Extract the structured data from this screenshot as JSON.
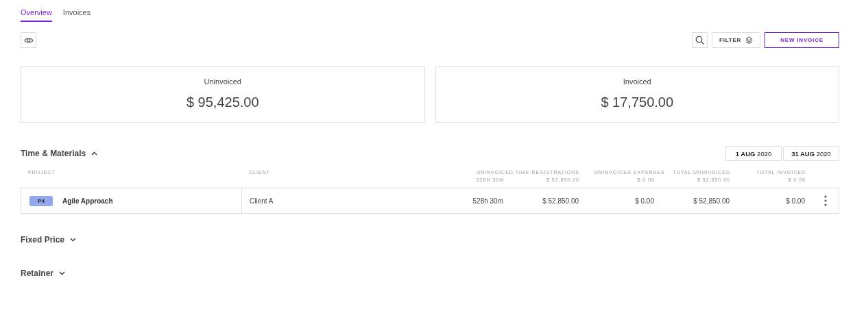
{
  "tabs": [
    {
      "label": "Overview",
      "selected": true
    },
    {
      "label": "Invoices",
      "selected": false
    }
  ],
  "toolbar": {
    "filter_label": "FILTER",
    "new_invoice_label": "NEW INVOICE"
  },
  "summary": [
    {
      "label": "Uninvoiced",
      "amount": "$ 95,425.00"
    },
    {
      "label": "Invoiced",
      "amount": "$ 17,750.00"
    }
  ],
  "sections": [
    {
      "title": "Time & Materials",
      "expanded": true,
      "dates": [
        "**1 AUG** 2020",
        "**31 AUG** 2020"
      ],
      "table": {
        "columns": [
          {
            "label": "PROJECT"
          },
          {
            "label": "CLIENT"
          },
          {
            "label": "UNINVOICED TIME REGISTRATIONS",
            "subtotals": [
              "528H 30M",
              "$ 52,850.00"
            ]
          },
          {
            "label": "UNINVOICED EXPENSES",
            "subtotals": [
              "$ 0.00"
            ]
          },
          {
            "label": "TOTAL UNINVOICED",
            "subtotals": [
              "$ 52,850.00"
            ]
          },
          {
            "label": "TOTAL INVOICED",
            "subtotals": [
              "$ 0.00"
            ]
          }
        ],
        "rows": [
          {
            "badge": "P4",
            "color": "#94a7ec",
            "project": "Agile Approach",
            "client": "Client A",
            "hours": "528h 30m",
            "time_amount": "$ 52,850.00",
            "expenses": "$ 0.00",
            "total_uninvoiced": "$ 52,850.00",
            "total_invoiced": "$ 0.00"
          }
        ]
      }
    },
    {
      "title": "Fixed Price",
      "expanded": false
    },
    {
      "title": "Retainer",
      "expanded": false
    }
  ]
}
